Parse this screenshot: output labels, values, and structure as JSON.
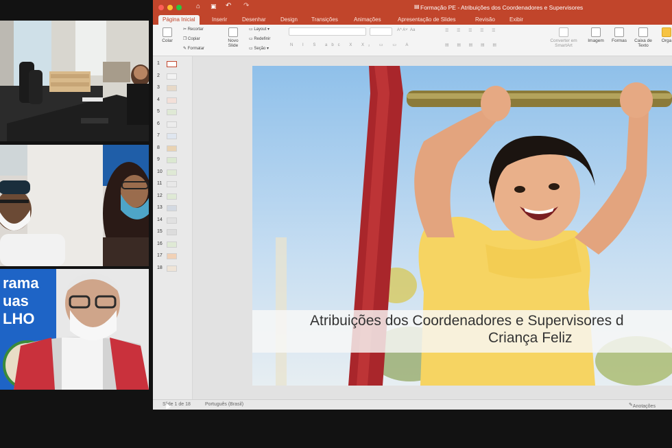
{
  "ppt": {
    "window_title": "Formação PE - Atribuições dos Coordenadores e Supervisores",
    "tabs": [
      "Página Inicial",
      "Inserir",
      "Desenhar",
      "Design",
      "Transições",
      "Animações",
      "Apresentação de Slides",
      "Revisão",
      "Exibir"
    ],
    "toolbar": {
      "colar": "Colar",
      "recortar": "Recortar",
      "copiar": "Copiar",
      "formatar": "Formatar",
      "novo_slide": "Novo Slide",
      "layout": "Layout",
      "redefinir": "Redefinir",
      "secao": "Seção",
      "converter": "Converter em SmartArt",
      "imagem": "Imagem",
      "formas": "Formas",
      "caixa_texto": "Caixa de Texto",
      "organizar": "Orga"
    },
    "slide_numbers": [
      "1",
      "2",
      "3",
      "4",
      "5",
      "6",
      "7",
      "8",
      "9",
      "10",
      "11",
      "12",
      "13",
      "14",
      "15",
      "16",
      "17",
      "18"
    ],
    "slide_title_line1": "Atribuições dos Coordenadores e Supervisores d",
    "slide_title_line2": "Criança Feliz",
    "status": {
      "slide_counter": "Slide 1 de 18",
      "language": "Português (Brasil)",
      "notes": "Anotações"
    }
  },
  "participants": {
    "tile3_banner": [
      "rama",
      "uas",
      "LHO"
    ]
  },
  "colors": {
    "ppt_accent": "#c1452b",
    "meeting_bg": "#121212"
  }
}
